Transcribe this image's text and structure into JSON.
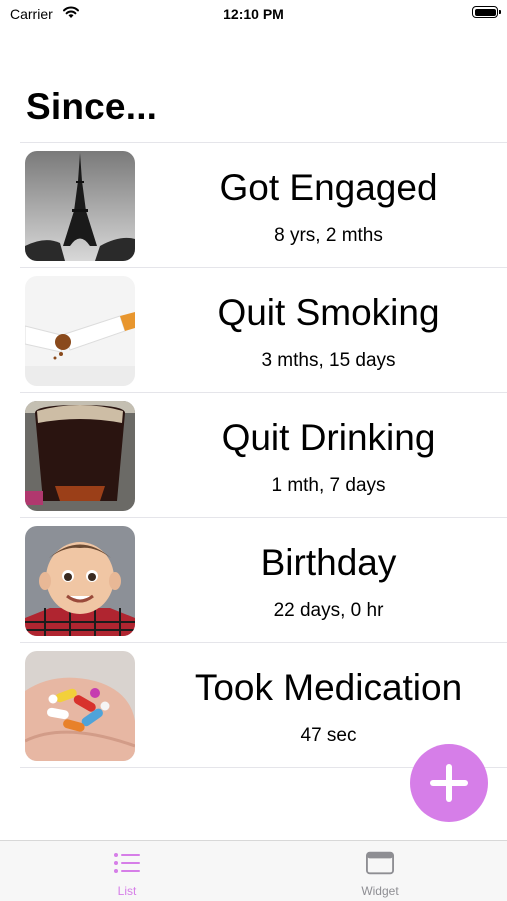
{
  "status_bar": {
    "carrier": "Carrier",
    "time": "12:10 PM"
  },
  "header": {
    "title": "Since..."
  },
  "items": [
    {
      "title": "Got Engaged",
      "elapsed": "8 yrs, 2 mths",
      "image": "eiffel-tower-photo"
    },
    {
      "title": "Quit Smoking",
      "elapsed": "3 mths, 15 days",
      "image": "broken-cigarette-photo"
    },
    {
      "title": "Quit Drinking",
      "elapsed": "1 mth, 7 days",
      "image": "glass-of-beer-photo"
    },
    {
      "title": "Birthday",
      "elapsed": "22 days, 0 hr",
      "image": "baby-face-photo"
    },
    {
      "title": "Took Medication",
      "elapsed": "47 sec",
      "image": "pills-in-hand-photo"
    }
  ],
  "tab_bar": {
    "tabs": [
      {
        "label": "List",
        "icon": "list-icon",
        "selected": true
      },
      {
        "label": "Widget",
        "icon": "widget-icon",
        "selected": false
      }
    ]
  },
  "colors": {
    "accent": "#d67ee8",
    "separator": "#e5e5ea",
    "inactive_tab": "#8e8e93"
  }
}
